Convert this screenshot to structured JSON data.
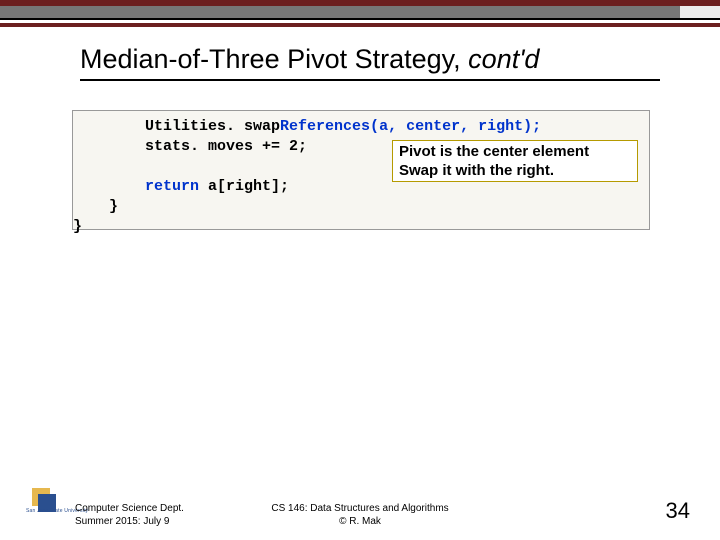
{
  "title": {
    "main": "Median-of-Three Pivot Strategy, ",
    "italic": "cont'd"
  },
  "code": {
    "line1a": "        Utilities. swap",
    "line1b": "References(a, center, right);",
    "line2": "        stats. moves += 2;",
    "line3": "",
    "line4a": "        ",
    "line4b": "return",
    "line4c": " a[right];",
    "line5": "    }",
    "line6": "}"
  },
  "annotation": {
    "line1": "Pivot is the center element",
    "line2": "Swap it with the right."
  },
  "footer": {
    "dept": "Computer Science Dept.",
    "term": "Summer 2015: July 9",
    "course": "CS 146: Data Structures and Algorithms",
    "copyright": "© R. Mak",
    "page": "34"
  },
  "logo": {
    "name": "San Jose State University"
  }
}
